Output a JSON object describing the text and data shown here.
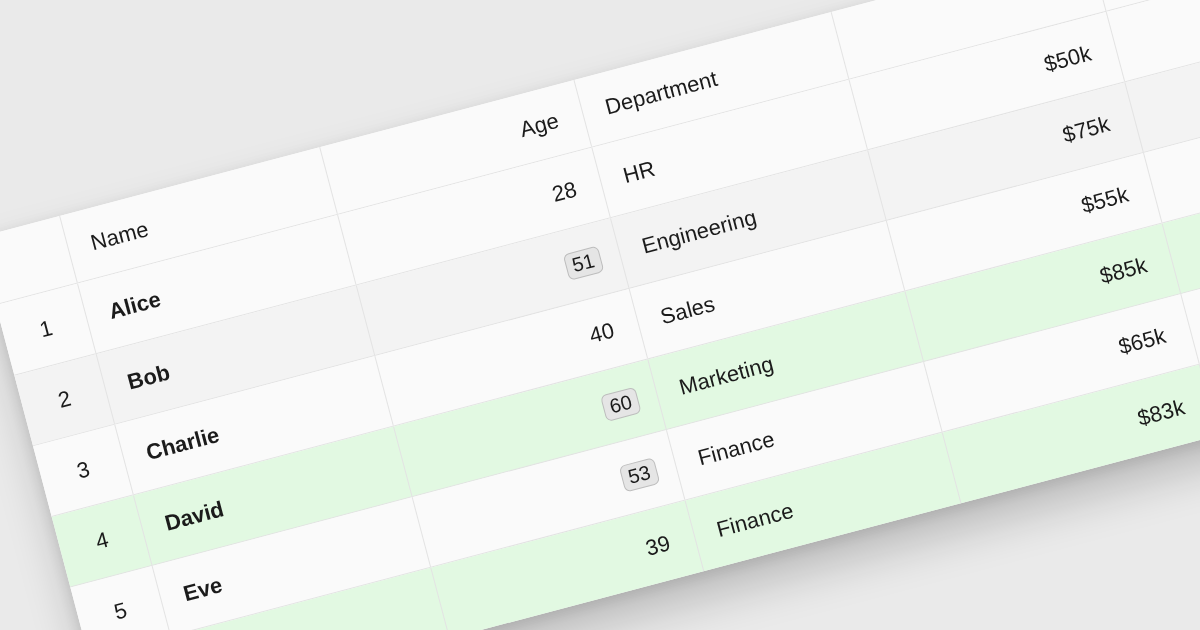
{
  "table": {
    "header": {
      "name": "Name",
      "age": "Age",
      "department": "Department"
    },
    "rows": [
      {
        "number": "1",
        "name": "Alice",
        "age": "28",
        "age_badge": false,
        "department": "HR",
        "column_5": "$50k",
        "highlighted": false
      },
      {
        "number": "2",
        "name": "Bob",
        "age": "51",
        "age_badge": true,
        "department": "Engineering",
        "column_5": "$75k",
        "highlighted": false
      },
      {
        "number": "3",
        "name": "Charlie",
        "age": "40",
        "age_badge": false,
        "department": "Sales",
        "column_5": "$55k",
        "highlighted": false
      },
      {
        "number": "4",
        "name": "David",
        "age": "60",
        "age_badge": true,
        "department": "Marketing",
        "column_5": "$85k",
        "highlighted": true
      },
      {
        "number": "5",
        "name": "Eve",
        "age": "53",
        "age_badge": true,
        "department": "Finance",
        "column_5": "$65k",
        "highlighted": false
      },
      {
        "age": "39",
        "age_badge": false,
        "department": "Finance",
        "column_5": "$83k",
        "highlighted": true
      }
    ]
  }
}
